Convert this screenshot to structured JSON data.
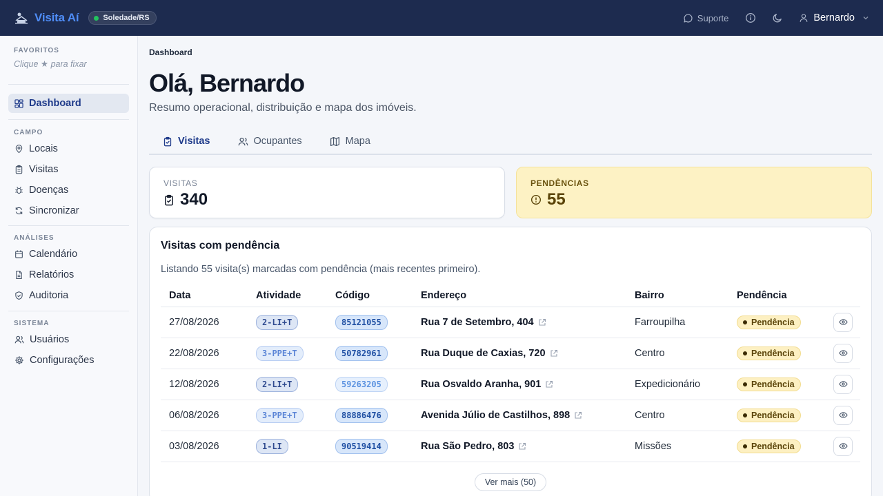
{
  "app": {
    "name": "Visita Aí",
    "city": "Soledade/RS",
    "support_label": "Suporte",
    "user_name": "Bernardo"
  },
  "sidebar": {
    "favorites_label": "FAVORITOS",
    "favorites_hint": "Clique ★ para fixar",
    "dashboard_label": "Dashboard",
    "sections": [
      {
        "label": "CAMPO",
        "items": [
          {
            "label": "Locais",
            "icon": "map-pin-icon"
          },
          {
            "label": "Visitas",
            "icon": "clipboard-icon"
          },
          {
            "label": "Doenças",
            "icon": "bug-icon"
          },
          {
            "label": "Sincronizar",
            "icon": "refresh-icon"
          }
        ]
      },
      {
        "label": "ANÁLISES",
        "items": [
          {
            "label": "Calendário",
            "icon": "calendar-icon"
          },
          {
            "label": "Relatórios",
            "icon": "file-icon"
          },
          {
            "label": "Auditoria",
            "icon": "shield-check-icon"
          }
        ]
      },
      {
        "label": "SISTEMA",
        "items": [
          {
            "label": "Usuários",
            "icon": "users-icon"
          },
          {
            "label": "Configurações",
            "icon": "gear-icon"
          }
        ]
      }
    ]
  },
  "main": {
    "breadcrumb": "Dashboard",
    "title": "Olá, Bernardo",
    "subtitle": "Resumo operacional, distribuição e mapa dos imóveis.",
    "tabs": [
      {
        "label": "Visitas",
        "active": true
      },
      {
        "label": "Ocupantes",
        "active": false
      },
      {
        "label": "Mapa",
        "active": false
      }
    ],
    "stats": {
      "visitas_label": "VISITAS",
      "visitas_value": "340",
      "pendencias_label": "PENDÊNCIAS",
      "pendencias_value": "55"
    },
    "panel": {
      "title": "Visitas com pendência",
      "description": "Listando 55 visita(s) marcadas com pendência (mais recentes primeiro).",
      "columns": [
        "Data",
        "Atividade",
        "Código",
        "Endereço",
        "Bairro",
        "Pendência"
      ],
      "rows": [
        {
          "data": "27/08/2026",
          "atividade": "2-LI+T",
          "codigo": "85121055",
          "endereco": "Rua 7 de Setembro, 404",
          "bairro": "Farroupilha",
          "pendencia": "Pendência"
        },
        {
          "data": "22/08/2026",
          "atividade": "3-PPE+T",
          "codigo": "50782961",
          "endereco": "Rua Duque de Caxias, 720",
          "bairro": "Centro",
          "pendencia": "Pendência"
        },
        {
          "data": "12/08/2026",
          "atividade": "2-LI+T",
          "codigo": "59263205",
          "endereco": "Rua Osvaldo Aranha, 901",
          "bairro": "Expedicionário",
          "pendencia": "Pendência"
        },
        {
          "data": "06/08/2026",
          "atividade": "3-PPE+T",
          "codigo": "88886476",
          "endereco": "Avenida Júlio de Castilhos, 898",
          "bairro": "Centro",
          "pendencia": "Pendência"
        },
        {
          "data": "03/08/2026",
          "atividade": "1-LI",
          "codigo": "90519414",
          "endereco": "Rua São Pedro, 803",
          "bairro": "Missões",
          "pendencia": "Pendência"
        }
      ],
      "more_label": "Ver mais (50)"
    }
  },
  "colors": {
    "topbar": "#1d2b4f",
    "brand": "#4f8df7",
    "accent": "#1e3a8a",
    "pending_bg": "#fdf2c4"
  }
}
